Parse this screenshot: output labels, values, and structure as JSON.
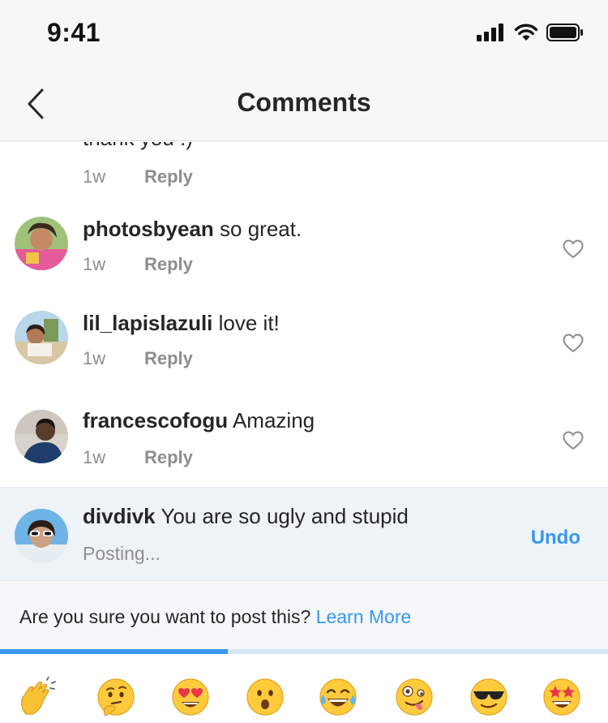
{
  "status_bar": {
    "time": "9:41"
  },
  "header": {
    "title": "Comments",
    "back_icon": "chevron-left-icon"
  },
  "partial_comment": {
    "text": "thank you :)",
    "time": "1w",
    "reply_label": "Reply"
  },
  "comments": [
    {
      "username": "photosbyean",
      "text": "so great.",
      "time": "1w",
      "reply_label": "Reply"
    },
    {
      "username": "lil_lapislazuli",
      "text": "love it!",
      "time": "1w",
      "reply_label": "Reply"
    },
    {
      "username": "francescofogu",
      "text": "Amazing",
      "time": "1w",
      "reply_label": "Reply"
    }
  ],
  "pending_comment": {
    "username": "divdivk",
    "text": "You are so ugly and stupid",
    "status": "Posting...",
    "undo_label": "Undo"
  },
  "warning": {
    "text": "Are you sure you want to post this?",
    "link": "Learn More"
  },
  "progress": {
    "fraction": 0.375
  },
  "colors": {
    "accent": "#3897f0",
    "muted": "#8e8e8e",
    "text": "#262626"
  },
  "emoji_bar": [
    "clapping-hands",
    "thinking-face",
    "heart-eyes-face",
    "surprised-face",
    "tears-of-joy-face",
    "zany-face",
    "sunglasses-face",
    "star-struck-face"
  ]
}
